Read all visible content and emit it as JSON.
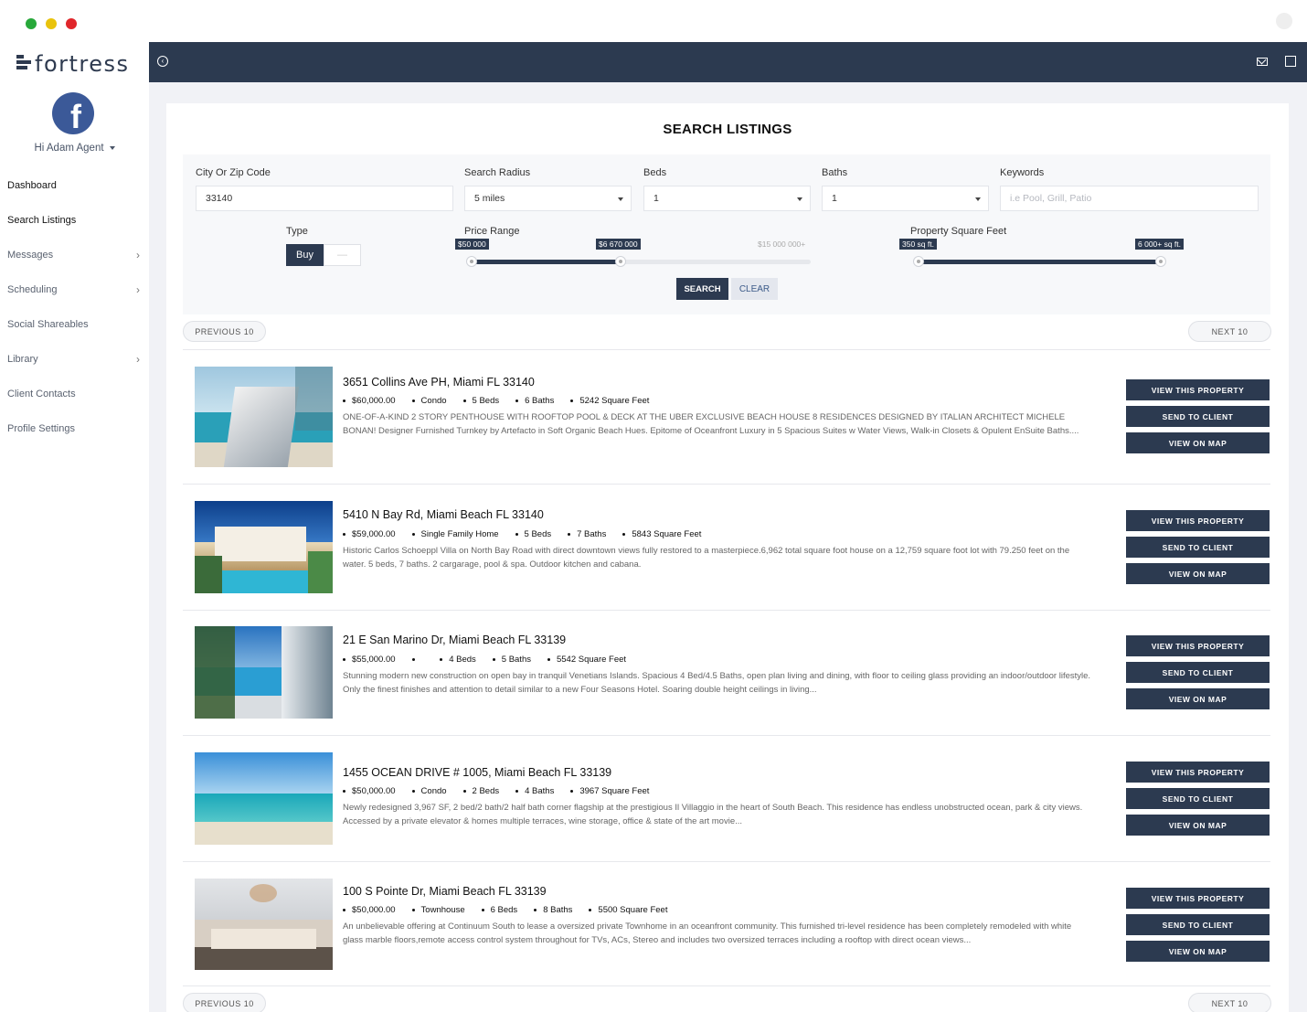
{
  "brand": {
    "name": "fortress"
  },
  "user": {
    "greeting": "Hi Adam Agent"
  },
  "sidebar": {
    "items": [
      {
        "label": "Dashboard",
        "has_children": false
      },
      {
        "label": "Search Listings",
        "has_children": false
      },
      {
        "label": "Messages",
        "has_children": true
      },
      {
        "label": "Scheduling",
        "has_children": true
      },
      {
        "label": "Social Shareables",
        "has_children": false
      },
      {
        "label": "Library",
        "has_children": true
      },
      {
        "label": "Client Contacts",
        "has_children": false
      },
      {
        "label": "Profile Settings",
        "has_children": false
      }
    ],
    "active": "Search Listings"
  },
  "topbar": {
    "icons": [
      "back-circle-icon",
      "mail-icon",
      "edit-icon"
    ]
  },
  "page": {
    "title": "SEARCH LISTINGS"
  },
  "search": {
    "city_label": "City Or Zip Code",
    "city_value": "33140",
    "radius_label": "Search Radius",
    "radius_value": "5 miles",
    "beds_label": "Beds",
    "beds_value": "1",
    "baths_label": "Baths",
    "baths_value": "1",
    "keywords_label": "Keywords",
    "keywords_placeholder": "i.e Pool, Grill, Patio",
    "type_label": "Type",
    "type_on": "Buy",
    "type_off": "—",
    "price_label": "Price Range",
    "price_min": "$50 000",
    "price_max": "$6 670 000",
    "price_cap": "$15 000 000+",
    "price_fill_fraction": [
      0.0,
      0.44
    ],
    "sqft_label": "Property Square Feet",
    "sqft_min": "350 sq ft.",
    "sqft_max": "6 000+ sq ft.",
    "sqft_fill_fraction": [
      0.0,
      1.0
    ],
    "search_btn": "SEARCH",
    "clear_btn": "CLEAR"
  },
  "pager": {
    "prev": "PREVIOUS 10",
    "next": "NEXT 10"
  },
  "actions": {
    "view": "VIEW THIS PROPERTY",
    "send": "SEND TO CLIENT",
    "map": "VIEW ON MAP"
  },
  "listings": [
    {
      "title": "3651 Collins Ave PH, Miami FL 33140",
      "meta": [
        "$60,000.00",
        "Condo",
        "5 Beds",
        "6 Baths",
        "5242 Square Feet"
      ],
      "desc": "ONE-OF-A-KIND 2 STORY PENTHOUSE WITH ROOFTOP POOL & DECK AT THE UBER EXCLUSIVE BEACH HOUSE 8 RESIDENCES DESIGNED BY ITALIAN ARCHITECT MICHELE BONAN! Designer Furnished Turnkey by Artefacto in Soft Organic Beach Hues. Epitome of Oceanfront Luxury in 5 Spacious Suites w Water Views, Walk-in Closets & Opulent EnSuite Baths...."
    },
    {
      "title": "5410 N Bay Rd, Miami Beach FL 33140",
      "meta": [
        "$59,000.00",
        "Single Family Home",
        "5 Beds",
        "7 Baths",
        "5843 Square Feet"
      ],
      "desc": "Historic Carlos Schoeppl Villa on North Bay Road with direct downtown views fully restored to a masterpiece.6,962 total square foot house on a 12,759 square foot lot with 79.250 feet on the water. 5 beds, 7 baths. 2 cargarage, pool & spa. Outdoor kitchen and cabana."
    },
    {
      "title": "21 E San Marino Dr, Miami Beach FL 33139",
      "meta": [
        "$55,000.00",
        "",
        "4 Beds",
        "5 Baths",
        "5542 Square Feet"
      ],
      "desc": "Stunning modern new construction on open bay in tranquil Venetians Islands. Spacious 4 Bed/4.5 Baths, open plan living and dining, with floor to ceiling glass providing an indoor/outdoor lifestyle. Only the finest finishes and attention to detail similar to a new Four Seasons Hotel. Soaring double height ceilings in living..."
    },
    {
      "title": "1455 OCEAN DRIVE # 1005, Miami Beach FL 33139",
      "meta": [
        "$50,000.00",
        "Condo",
        "2 Beds",
        "4 Baths",
        "3967 Square Feet"
      ],
      "desc": "Newly redesigned 3,967 SF, 2 bed/2 bath/2 half bath corner flagship at the prestigious Il Villaggio in the heart of South Beach. This residence has endless unobstructed ocean, park & city views. Accessed by a private elevator & homes multiple terraces, wine storage, office & state of the art movie..."
    },
    {
      "title": "100 S Pointe Dr, Miami Beach FL 33139",
      "meta": [
        "$50,000.00",
        "Townhouse",
        "6 Beds",
        "8 Baths",
        "5500 Square Feet"
      ],
      "desc": "An unbelievable offering at Continuum South to lease a oversized private Townhome in an oceanfront community. This furnished tri-level residence has been completely remodeled with white glass marble floors,remote access control system throughout for TVs, ACs, Stereo and includes two oversized terraces including a rooftop with direct ocean views..."
    }
  ]
}
